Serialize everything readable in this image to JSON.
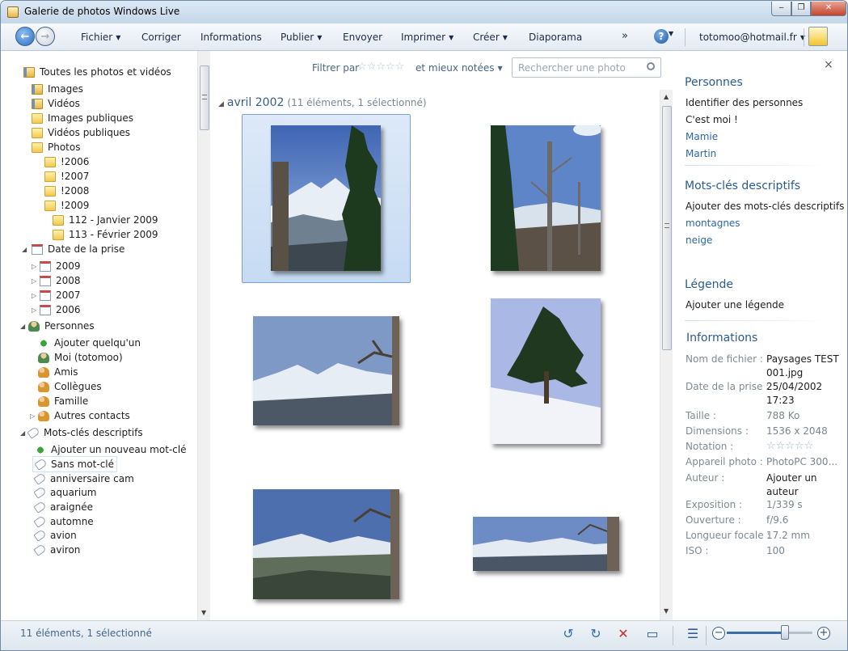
{
  "window": {
    "title": "Galerie de photos Windows Live",
    "controls": {
      "minimize": "‒",
      "maximize": "❐",
      "close": "✕"
    }
  },
  "menu": {
    "items": [
      "Fichier",
      "Corriger",
      "Informations",
      "Publier",
      "Envoyer",
      "Imprimer",
      "Créer",
      "Diaporama"
    ],
    "more": "»",
    "help": "?",
    "account": "totomoo@hotmail.fr"
  },
  "tree": {
    "root": "Toutes les photos et vidéos",
    "items": [
      "Images",
      "Vidéos",
      "Images publiques",
      "Vidéos publiques",
      "Photos"
    ],
    "photo_folders": [
      "!2006",
      "!2007",
      "!2008",
      "!2009"
    ],
    "sub_folders": [
      "112 - Janvier 2009",
      "113 - Février 2009"
    ],
    "date_section": "Date de la prise",
    "years": [
      "2009",
      "2008",
      "2007",
      "2006"
    ],
    "people_section": "Personnes",
    "people": [
      "Ajouter quelqu'un",
      "Moi (totomoo)",
      "Amis",
      "Collègues",
      "Famille",
      "Autres contacts"
    ],
    "tags_section": "Mots-clés descriptifs",
    "tags": [
      "Ajouter un nouveau mot-clé",
      "Sans mot-clé",
      "anniversaire cam",
      "aquarium",
      "araignée",
      "automne",
      "avion",
      "aviron"
    ]
  },
  "toolbar": {
    "filter_label": "Filtrer par",
    "stars": "☆☆☆☆☆",
    "filter_suffix": "et mieux notées",
    "search_placeholder": "Rechercher une photo"
  },
  "group": {
    "title": "avril 2002",
    "subtitle": "(11 éléments, 1 sélectionné)"
  },
  "details": {
    "close": "×",
    "people_heading": "Personnes",
    "people_action": "Identifier des personnes",
    "people_me": "C'est moi !",
    "people_tags": [
      "Mamie",
      "Martin"
    ],
    "tags_heading": "Mots-clés descriptifs",
    "tags_action": "Ajouter des mots-clés descriptifs",
    "tags": [
      "montagnes",
      "neige"
    ],
    "caption_heading": "Légende",
    "caption_action": "Ajouter une légende",
    "info_heading": "Informations",
    "info": [
      {
        "k": "Nom de fichier :",
        "v": "Paysages TEST 001.jpg"
      },
      {
        "k": "Date de la prise :",
        "v": "25/04/2002 17:23"
      },
      {
        "k": "Taille :",
        "v": "788 Ko"
      },
      {
        "k": "Dimensions :",
        "v": "1536 x 2048"
      },
      {
        "k": "Notation :",
        "v": "☆☆☆☆☆"
      },
      {
        "k": "Appareil photo :",
        "v": "PhotoPC 300..."
      },
      {
        "k": "Auteur :",
        "v": "Ajouter un auteur"
      },
      {
        "k": "Exposition :",
        "v": "1/339 s"
      },
      {
        "k": "Ouverture :",
        "v": "f/9.6"
      },
      {
        "k": "Longueur focale :",
        "v": "17.2 mm"
      },
      {
        "k": "ISO :",
        "v": "100"
      }
    ]
  },
  "status": {
    "text": "11 éléments, 1 sélectionné",
    "zoom_level": 0.68
  },
  "colors": {
    "accent": "#2b5c8f",
    "link": "#2c67a8",
    "selection": "#c6dbf3"
  }
}
